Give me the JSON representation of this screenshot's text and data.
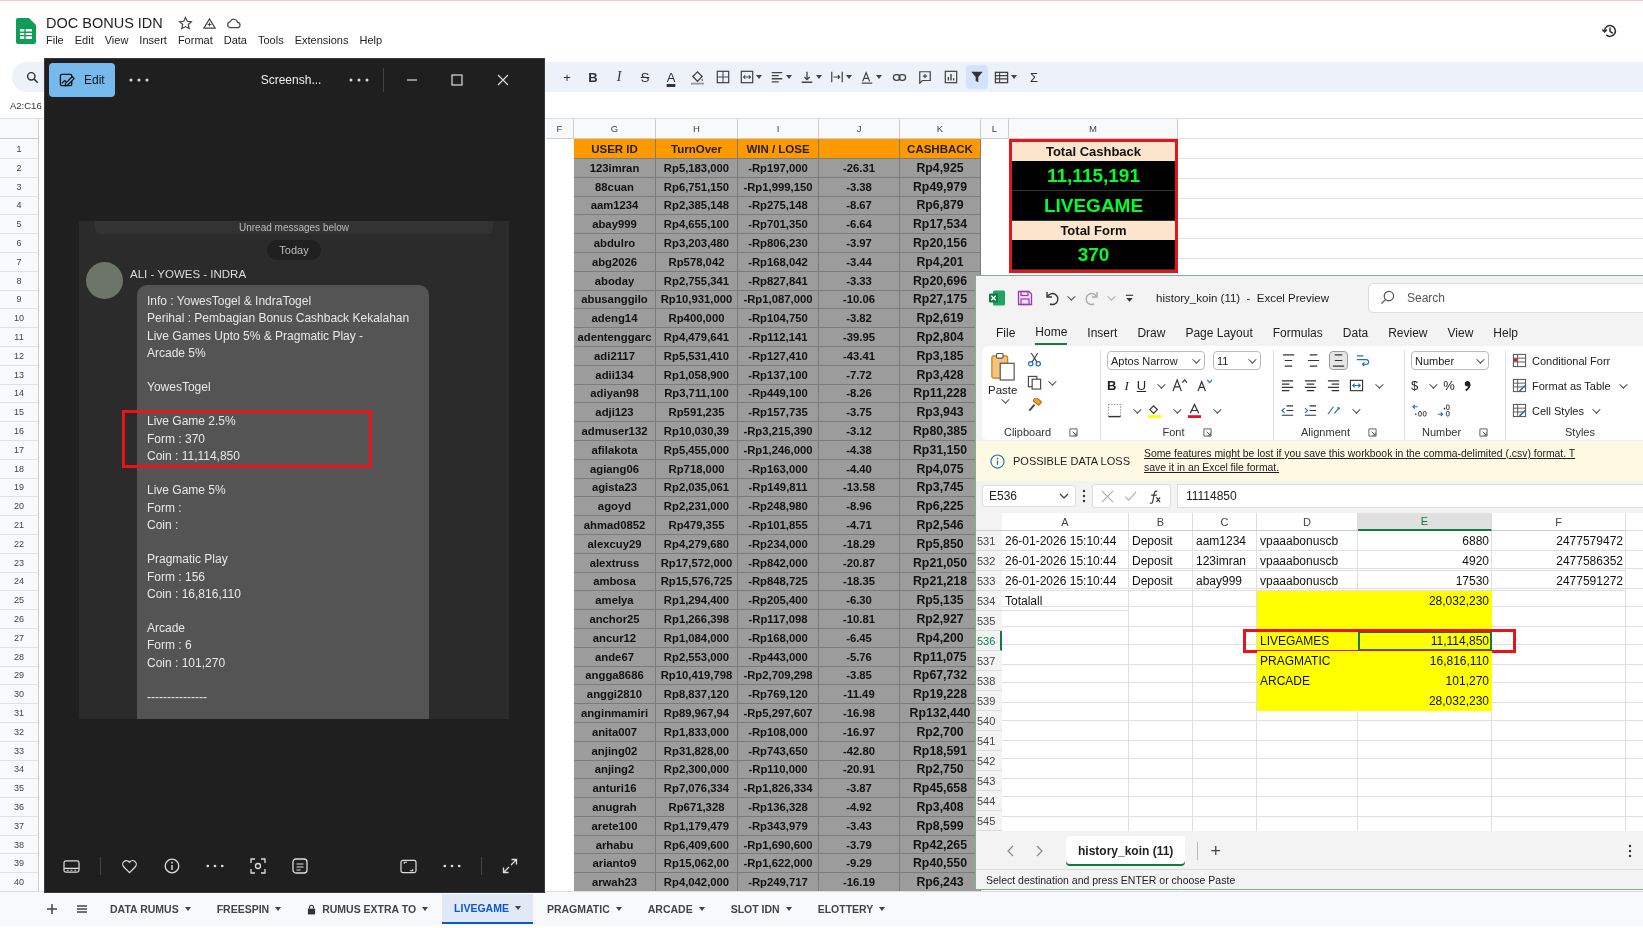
{
  "sheets": {
    "doc_title": "DOC BONUS IDN",
    "menu": [
      "File",
      "Edit",
      "View",
      "Insert",
      "Format",
      "Data",
      "Tools",
      "Extensions",
      "Help"
    ],
    "toolbar": [
      {
        "kind": "plain",
        "label": "+",
        "active": false
      },
      {
        "kind": "bold",
        "label": "B",
        "active": false
      },
      {
        "kind": "italic",
        "label": "I",
        "active": false
      },
      {
        "kind": "strike",
        "label": "S",
        "active": false
      },
      {
        "kind": "text-color",
        "label": "A",
        "active": false
      },
      {
        "kind": "fill",
        "active": false
      },
      {
        "kind": "borders",
        "active": false
      },
      {
        "kind": "merge",
        "active": false
      },
      {
        "kind": "halign",
        "active": false
      },
      {
        "kind": "valign",
        "active": false
      },
      {
        "kind": "wrap",
        "active": false
      },
      {
        "kind": "rotate",
        "active": false
      },
      {
        "kind": "link",
        "active": false
      },
      {
        "kind": "comment",
        "active": false
      },
      {
        "kind": "chart",
        "active": false
      },
      {
        "kind": "filter",
        "active": true
      },
      {
        "kind": "table",
        "active": false
      },
      {
        "kind": "plain",
        "label": "Σ",
        "active": false
      }
    ],
    "name_box": "A2:C16",
    "column_letters": [
      "F",
      "G",
      "H",
      "I",
      "J",
      "K",
      "L",
      "M"
    ],
    "row_numbers": [
      "1",
      "2",
      "3",
      "4",
      "5",
      "6",
      "7",
      "8",
      "9",
      "10",
      "11",
      "12",
      "13",
      "14",
      "15",
      "16",
      "17",
      "18",
      "19",
      "20",
      "21",
      "22",
      "23",
      "24",
      "25",
      "26",
      "27",
      "28",
      "29",
      "30",
      "31",
      "32",
      "33",
      "34",
      "35",
      "36",
      "37",
      "38",
      "39",
      "40"
    ],
    "table": {
      "headers": {
        "user_id": "USER ID",
        "turnover": "TurnOver",
        "win_lose": "WIN / LOSE",
        "cashback": "CASHBACK"
      },
      "rows": [
        {
          "user_id": "123imran",
          "turnover": "Rp5,183,000",
          "win_lose": "-Rp197,000",
          "column_4": "-26.31",
          "cashback": "Rp4,925"
        },
        {
          "user_id": "88cuan",
          "turnover": "Rp6,751,150",
          "win_lose": "-Rp1,999,150",
          "column_4": "-3.38",
          "cashback": "Rp49,979"
        },
        {
          "user_id": "aam1234",
          "turnover": "Rp2,385,148",
          "win_lose": "-Rp275,148",
          "column_4": "-8.67",
          "cashback": "Rp6,879"
        },
        {
          "user_id": "abay999",
          "turnover": "Rp4,655,100",
          "win_lose": "-Rp701,350",
          "column_4": "-6.64",
          "cashback": "Rp17,534"
        },
        {
          "user_id": "abdulro",
          "turnover": "Rp3,203,480",
          "win_lose": "-Rp806,230",
          "column_4": "-3.97",
          "cashback": "Rp20,156"
        },
        {
          "user_id": "abg2026",
          "turnover": "Rp578,042",
          "win_lose": "-Rp168,042",
          "column_4": "-3.44",
          "cashback": "Rp4,201"
        },
        {
          "user_id": "aboday",
          "turnover": "Rp2,755,341",
          "win_lose": "-Rp827,841",
          "column_4": "-3.33",
          "cashback": "Rp20,696"
        },
        {
          "user_id": "abusanggilo",
          "turnover": "Rp10,931,000",
          "win_lose": "-Rp1,087,000",
          "column_4": "-10.06",
          "cashback": "Rp27,175"
        },
        {
          "user_id": "adeng14",
          "turnover": "Rp400,000",
          "win_lose": "-Rp104,750",
          "column_4": "-3.82",
          "cashback": "Rp2,619"
        },
        {
          "user_id": "adentenggarc",
          "turnover": "Rp4,479,641",
          "win_lose": "-Rp112,141",
          "column_4": "-39.95",
          "cashback": "Rp2,804"
        },
        {
          "user_id": "adi2117",
          "turnover": "Rp5,531,410",
          "win_lose": "-Rp127,410",
          "column_4": "-43.41",
          "cashback": "Rp3,185"
        },
        {
          "user_id": "adii134",
          "turnover": "Rp1,058,900",
          "win_lose": "-Rp137,100",
          "column_4": "-7.72",
          "cashback": "Rp3,428"
        },
        {
          "user_id": "adiyan98",
          "turnover": "Rp3,711,100",
          "win_lose": "-Rp449,100",
          "column_4": "-8.26",
          "cashback": "Rp11,228"
        },
        {
          "user_id": "adji123",
          "turnover": "Rp591,235",
          "win_lose": "-Rp157,735",
          "column_4": "-3.75",
          "cashback": "Rp3,943"
        },
        {
          "user_id": "admuser132",
          "turnover": "Rp10,030,39",
          "win_lose": "-Rp3,215,390",
          "column_4": "-3.12",
          "cashback": "Rp80,385"
        },
        {
          "user_id": "afilakota",
          "turnover": "Rp5,455,000",
          "win_lose": "-Rp1,246,000",
          "column_4": "-4.38",
          "cashback": "Rp31,150"
        },
        {
          "user_id": "agiang06",
          "turnover": "Rp718,000",
          "win_lose": "-Rp163,000",
          "column_4": "-4.40",
          "cashback": "Rp4,075"
        },
        {
          "user_id": "agista23",
          "turnover": "Rp2,035,061",
          "win_lose": "-Rp149,811",
          "column_4": "-13.58",
          "cashback": "Rp3,745"
        },
        {
          "user_id": "agoyd",
          "turnover": "Rp2,231,000",
          "win_lose": "-Rp248,980",
          "column_4": "-8.96",
          "cashback": "Rp6,225"
        },
        {
          "user_id": "ahmad0852",
          "turnover": "Rp479,355",
          "win_lose": "-Rp101,855",
          "column_4": "-4.71",
          "cashback": "Rp2,546"
        },
        {
          "user_id": "alexcuy29",
          "turnover": "Rp4,279,680",
          "win_lose": "-Rp234,000",
          "column_4": "-18.29",
          "cashback": "Rp5,850"
        },
        {
          "user_id": "alextruss",
          "turnover": "Rp17,572,000",
          "win_lose": "-Rp842,000",
          "column_4": "-20.87",
          "cashback": "Rp21,050"
        },
        {
          "user_id": "ambosa",
          "turnover": "Rp15,576,725",
          "win_lose": "-Rp848,725",
          "column_4": "-18.35",
          "cashback": "Rp21,218"
        },
        {
          "user_id": "amelya",
          "turnover": "Rp1,294,400",
          "win_lose": "-Rp205,400",
          "column_4": "-6.30",
          "cashback": "Rp5,135"
        },
        {
          "user_id": "anchor25",
          "turnover": "Rp1,266,398",
          "win_lose": "-Rp117,098",
          "column_4": "-10.81",
          "cashback": "Rp2,927"
        },
        {
          "user_id": "ancur12",
          "turnover": "Rp1,084,000",
          "win_lose": "-Rp168,000",
          "column_4": "-6.45",
          "cashback": "Rp4,200"
        },
        {
          "user_id": "ande67",
          "turnover": "Rp2,553,000",
          "win_lose": "-Rp443,000",
          "column_4": "-5.76",
          "cashback": "Rp11,075"
        },
        {
          "user_id": "angga8686",
          "turnover": "Rp10,419,798",
          "win_lose": "-Rp2,709,298",
          "column_4": "-3.85",
          "cashback": "Rp67,732"
        },
        {
          "user_id": "anggi2810",
          "turnover": "Rp8,837,120",
          "win_lose": "-Rp769,120",
          "column_4": "-11.49",
          "cashback": "Rp19,228"
        },
        {
          "user_id": "anginmamiri",
          "turnover": "Rp89,967,94",
          "win_lose": "-Rp5,297,607",
          "column_4": "-16.98",
          "cashback": "Rp132,440"
        },
        {
          "user_id": "anita007",
          "turnover": "Rp1,833,000",
          "win_lose": "-Rp108,000",
          "column_4": "-16.97",
          "cashback": "Rp2,700"
        },
        {
          "user_id": "anjing02",
          "turnover": "Rp31,828,00",
          "win_lose": "-Rp743,650",
          "column_4": "-42.80",
          "cashback": "Rp18,591"
        },
        {
          "user_id": "anjing2",
          "turnover": "Rp2,300,000",
          "win_lose": "-Rp110,000",
          "column_4": "-20.91",
          "cashback": "Rp2,750"
        },
        {
          "user_id": "anturi16",
          "turnover": "Rp7,076,334",
          "win_lose": "-Rp1,826,334",
          "column_4": "-3.87",
          "cashback": "Rp45,658"
        },
        {
          "user_id": "anugrah",
          "turnover": "Rp671,328",
          "win_lose": "-Rp136,328",
          "column_4": "-4.92",
          "cashback": "Rp3,408"
        },
        {
          "user_id": "arete100",
          "turnover": "Rp1,179,479",
          "win_lose": "-Rp343,979",
          "column_4": "-3.43",
          "cashback": "Rp8,599"
        },
        {
          "user_id": "arhabu",
          "turnover": "Rp6,409,600",
          "win_lose": "-Rp1,690,600",
          "column_4": "-3.79",
          "cashback": "Rp42,265"
        },
        {
          "user_id": "arianto9",
          "turnover": "Rp15,062,00",
          "win_lose": "-Rp1,622,000",
          "column_4": "-9.29",
          "cashback": "Rp40,550"
        },
        {
          "user_id": "arwah23",
          "turnover": "Rp4,042,000",
          "win_lose": "-Rp249,717",
          "column_4": "-16.19",
          "cashback": "Rp6,243"
        }
      ]
    },
    "summary_box": {
      "highlighted": true,
      "cells": [
        {
          "kind": "label",
          "text": "Total Cashback"
        },
        {
          "kind": "value",
          "text": "11,115,191"
        },
        {
          "kind": "value",
          "text": "LIVEGAME"
        },
        {
          "kind": "label",
          "text": "Total Form"
        },
        {
          "kind": "value",
          "text": "370"
        }
      ]
    },
    "sheet_tabs": [
      {
        "label": "DATA RUMUS",
        "selected": false,
        "locked": false
      },
      {
        "label": "FREESPIN",
        "selected": false,
        "locked": false
      },
      {
        "label": "RUMUS EXTRA TO",
        "selected": false,
        "locked": true
      },
      {
        "label": "LIVEGAME",
        "selected": true,
        "locked": false
      },
      {
        "label": "PRAGMATIC",
        "selected": false,
        "locked": false
      },
      {
        "label": "ARCADE",
        "selected": false,
        "locked": false
      },
      {
        "label": "SLOT IDN",
        "selected": false,
        "locked": false
      },
      {
        "label": "ELOTTERY",
        "selected": false,
        "locked": false
      }
    ]
  },
  "photo_viewer": {
    "edit_label": "Edit",
    "title": "Screensh...",
    "chat": {
      "banner": "Unread messages below",
      "day": "Today",
      "sender": "ALI - YOWES - INDRA",
      "blocks": [
        {
          "highlighted": false,
          "lines": [
            "Info : YowesTogel & IndraTogel",
            "Perihal : Pembagian Bonus Cashback Kekalahan",
            "Live Games Upto 5% & Pragmatic Play -",
            "Arcade 5%"
          ]
        },
        {
          "highlighted": false,
          "lines": [
            "YowesTogel"
          ]
        },
        {
          "highlighted": true,
          "lines": [
            "Live Game 2.5%",
            "Form : 370",
            "Coin : 11,114,850"
          ]
        },
        {
          "highlighted": false,
          "lines": [
            "Live Game 5%",
            "Form :",
            "Coin :"
          ]
        },
        {
          "highlighted": false,
          "lines": [
            "Pragmatic Play",
            "Form : 156",
            "Coin : 16,816,110"
          ]
        },
        {
          "highlighted": false,
          "lines": [
            "Arcade",
            "Form : 6",
            "Coin : 101,270"
          ]
        },
        {
          "highlighted": false,
          "lines": [
            "---------------"
          ]
        }
      ]
    }
  },
  "excel": {
    "title": "history_koin (11)  -  Excel Preview",
    "search_placeholder": "Search",
    "tabs": [
      {
        "label": "File",
        "selected": false
      },
      {
        "label": "Home",
        "selected": true
      },
      {
        "label": "Insert",
        "selected": false
      },
      {
        "label": "Draw",
        "selected": false
      },
      {
        "label": "Page Layout",
        "selected": false
      },
      {
        "label": "Formulas",
        "selected": false
      },
      {
        "label": "Data",
        "selected": false
      },
      {
        "label": "Review",
        "selected": false
      },
      {
        "label": "View",
        "selected": false
      },
      {
        "label": "Help",
        "selected": false
      }
    ],
    "ribbon": {
      "paste": "Paste",
      "font_name": "Aptos Narrow",
      "font_size": "11",
      "font_styles": [
        "B",
        "I",
        "U"
      ],
      "vertical_align": [
        {
          "kind": "top",
          "active": false
        },
        {
          "kind": "middle",
          "active": false
        },
        {
          "kind": "bottom",
          "active": true
        }
      ],
      "number_format": "Number",
      "number_symbols": [
        "$",
        "%"
      ],
      "styles": [
        "Conditional Forr",
        "Format as Table",
        "Cell Styles"
      ],
      "groups": [
        "Clipboard",
        "Font",
        "Alignment",
        "Number",
        "Styles"
      ]
    },
    "message": {
      "title": "POSSIBLE DATA LOSS",
      "lines": [
        "Some features might be lost if you save this workbook in the comma-delimited (.csv) format. T",
        "save it in an Excel file format."
      ]
    },
    "name_box": "E536",
    "formula": "11114850",
    "columns": [
      {
        "letter": "A",
        "selected": false
      },
      {
        "letter": "B",
        "selected": false
      },
      {
        "letter": "C",
        "selected": false
      },
      {
        "letter": "D",
        "selected": false
      },
      {
        "letter": "E",
        "selected": true
      },
      {
        "letter": "F",
        "selected": false
      }
    ],
    "rows": [
      {
        "number": "531",
        "a": "26-01-2026 15:10:44",
        "b": "Deposit",
        "c": "aam1234",
        "d": "vpaaabonuscb",
        "e": "6880",
        "f": "2477579472",
        "filled": false,
        "selected": false,
        "highlighted": false
      },
      {
        "number": "532",
        "a": "26-01-2026 15:10:44",
        "b": "Deposit",
        "c": "123imran",
        "d": "vpaaabonuscb",
        "e": "4920",
        "f": "2477586352",
        "filled": false,
        "selected": false,
        "highlighted": false
      },
      {
        "number": "533",
        "a": "26-01-2026 15:10:44",
        "b": "Deposit",
        "c": "abay999",
        "d": "vpaaabonuscb",
        "e": "17530",
        "f": "2477591272",
        "filled": false,
        "selected": false,
        "highlighted": false
      },
      {
        "number": "534",
        "a": "Totalall",
        "e": "28,032,230",
        "filled": true,
        "selected": false,
        "highlighted": false
      },
      {
        "number": "535",
        "filled": true,
        "selected": false,
        "highlighted": false
      },
      {
        "number": "536",
        "d": "LIVEGAMES",
        "e": "11,114,850",
        "filled": true,
        "selected": true,
        "highlighted": true
      },
      {
        "number": "537",
        "d": "PRAGMATIC",
        "e": "16,816,110",
        "filled": true,
        "selected": false,
        "highlighted": false
      },
      {
        "number": "538",
        "d": "ARCADE",
        "e": "101,270",
        "filled": true,
        "selected": false,
        "highlighted": false
      },
      {
        "number": "539",
        "e": "28,032,230",
        "filled": true,
        "selected": false,
        "highlighted": false
      },
      {
        "number": "540",
        "filled": false,
        "selected": false,
        "highlighted": false
      },
      {
        "number": "541",
        "filled": false,
        "selected": false,
        "highlighted": false
      },
      {
        "number": "542",
        "filled": false,
        "selected": false,
        "highlighted": false
      },
      {
        "number": "543",
        "filled": false,
        "selected": false,
        "highlighted": false
      },
      {
        "number": "544",
        "filled": false,
        "selected": false,
        "highlighted": false
      },
      {
        "number": "545",
        "filled": false,
        "selected": false,
        "highlighted": false
      }
    ],
    "sheet_tabs": [
      {
        "label": "history_koin (11)",
        "selected": true
      }
    ],
    "add_sheet": "+",
    "status": "Select destination and press ENTER or choose Paste"
  }
}
